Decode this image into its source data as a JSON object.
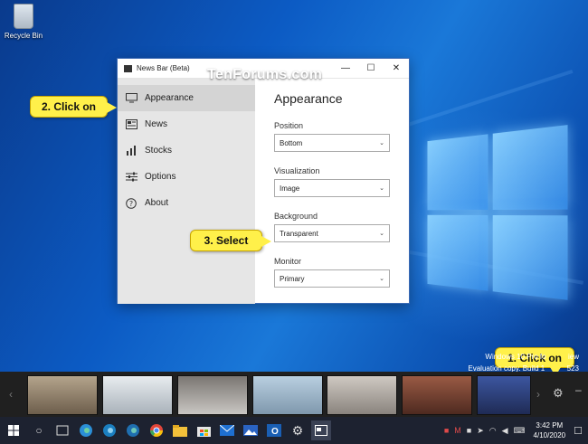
{
  "desktop": {
    "recycle_bin_label": "Recycle Bin",
    "watermark": "TenForums.com",
    "eval_line1": "Windows 10 Pro fo",
    "eval_line1_suffix": "iew",
    "eval_line2": "Evaluation copy. Build 1",
    "eval_line2_suffix": "523"
  },
  "window": {
    "title": "News Bar (Beta)",
    "controls": {
      "minimize": "—",
      "maximize": "☐",
      "close": "✕"
    },
    "sidebar": {
      "items": [
        {
          "label": "Appearance",
          "icon": "monitor-icon",
          "active": true
        },
        {
          "label": "News",
          "icon": "newspaper-icon",
          "active": false
        },
        {
          "label": "Stocks",
          "icon": "bar-chart-icon",
          "active": false
        },
        {
          "label": "Options",
          "icon": "sliders-icon",
          "active": false
        },
        {
          "label": "About",
          "icon": "question-icon",
          "active": false
        }
      ]
    },
    "content": {
      "heading": "Appearance",
      "fields": [
        {
          "label": "Position",
          "value": "Bottom"
        },
        {
          "label": "Visualization",
          "value": "Image"
        },
        {
          "label": "Background",
          "value": "Transparent"
        },
        {
          "label": "Monitor",
          "value": "Primary"
        }
      ]
    }
  },
  "callouts": {
    "step1": "1. Click on",
    "step2": "2. Click on",
    "step3": "3. Select"
  },
  "newsbar": {
    "thumbnail_colors": [
      "#8b7a66",
      "#cfd4d8",
      "#5e5a57",
      "#9fb6c8",
      "#b7b2ad",
      "#7a4a3a",
      "#2b3f7a"
    ]
  },
  "taskbar": {
    "time": "3:42 PM",
    "date": "4/10/2020"
  },
  "colors": {
    "callout": "#fff04a",
    "window_border": "#3c6bb5",
    "taskbar": "#1d2230",
    "newsbar": "#202020"
  }
}
